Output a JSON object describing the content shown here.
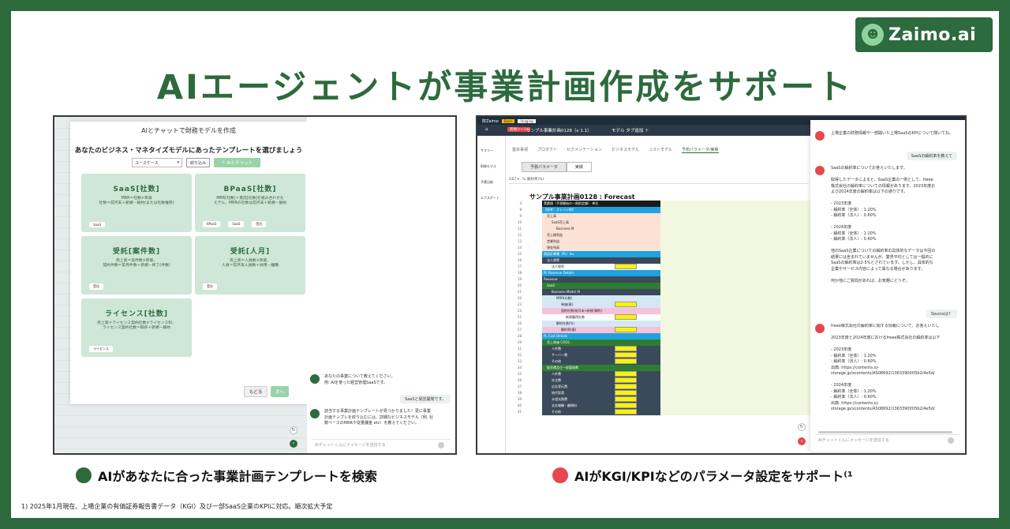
{
  "logo": {
    "text": "Zaimo.ai"
  },
  "headline": "AIエージェントが事業計画作成をサポート",
  "left": {
    "modal_title": "AIとチャットで財務モデルを作成",
    "modal_subtitle": "あなたのビジネス・マネタイズモデルにあったテンプレートを選びましょう",
    "select_value": "ユースケース",
    "filter_button": "絞り込み",
    "ai_chat_button": "AIとチャット",
    "cards": [
      {
        "title": "SaaS[社数]",
        "desc": "MRR＝社数×単価\n社数＝前月末＋新規－解約(または社数推移)",
        "tags": [
          "SaaS"
        ]
      },
      {
        "title": "BPaaS[社数]",
        "desc": "MRR[社数]＋受託[社数]を組み合わせた\nモデル。MRRの社数は前月末＋新規－解約",
        "tags": [
          "BPaaS",
          "SaaS",
          "受託"
        ]
      },
      {
        "title": "受託[案件数]",
        "desc": "売上高＝案件数×単価、\n契約件数＝前月件数＋新規－終了(件数)",
        "tags": [
          "受託"
        ]
      },
      {
        "title": "受託[人月]",
        "desc": "売上高＝人員数×単価、\n人員＝前月末人員数＋採用－離職",
        "tags": [
          "受託"
        ]
      },
      {
        "title": "ライセンス[社数]",
        "desc": "売上高＝ライセンス契約社数×ライセンス料、\nライセンス契約社数＝既存＋新規－解約",
        "tags": [
          "ライセンス"
        ]
      }
    ],
    "back_button": "もどる",
    "next_button": "次へ",
    "chat": {
      "bot1": "あなたの事業について教えてください。\n例: AIを使った経営管理SaaSです。",
      "user1": "SaaSと受託開発です。",
      "bot2": "該当する事業計画テンプレートが見つかりました！更に事業\n計画テンプレを絞り込むには、詳細なビジネスモデル（例. 社\n数ベースのMRRや従量課金 etc）を教えてください。",
      "input_placeholder": "AIチャットくんにメッセージを送信する"
    }
  },
  "right": {
    "app_name": "財Zaimo",
    "badge1": "Basic",
    "badge2": "Imaging",
    "tab_new": "新規シート",
    "tab_file": "サンプル事業計画0128（v 1.1）",
    "tab_model": "モデル タブ追加 ＋",
    "sidebar": [
      "サマリー",
      "財務モデル",
      "予実比較",
      "エクスポート"
    ],
    "subtabs": [
      "基本事項",
      "プロダクト",
      "セグメンテーション",
      "ビジネスモデル",
      "コストモデル",
      "予想パラメータ/実績"
    ],
    "toggle": [
      "予測パラメータ",
      "実績"
    ],
    "formula_bar": "G67  ▾  :  fx  解約率(%)",
    "sheet_title": "サンプル事業計画0128 : Forecast",
    "rows": [
      {
        "n": "4",
        "label": "実績値（予測開始の一期前定額）  単位",
        "bg": "#1a1a1a",
        "fg": "#fff",
        "indent": 0
      },
      {
        "n": "8",
        "label": "【参考：オレンジ枠】",
        "bg": "#1fa2e0",
        "fg": "#fff",
        "indent": 0
      },
      {
        "n": "9",
        "label": "売上高",
        "bg": "#fbe2d5",
        "fg": "#222",
        "indent": 4
      },
      {
        "n": "10",
        "label": "SaaS売上高",
        "bg": "#fbe2d5",
        "fg": "#222",
        "indent": 10
      },
      {
        "n": "11",
        "label": "Business M",
        "bg": "#fbe2d5",
        "fg": "#222",
        "indent": 16
      },
      {
        "n": "12",
        "label": "売上総利益",
        "bg": "#fbe2d5",
        "fg": "#222",
        "indent": 4
      },
      {
        "n": "13",
        "label": "営業利益",
        "bg": "#fbe2d5",
        "fg": "#222",
        "indent": 4
      },
      {
        "n": "14",
        "label": "現金残高",
        "bg": "#fbe2d5",
        "fg": "#222",
        "indent": 4
      },
      {
        "n": "15",
        "label": "損益計算書（PL）Inv",
        "bg": "#1fa2e0",
        "fg": "#fff",
        "indent": 0
      },
      {
        "n": "16",
        "label": "法人税等",
        "bg": "#3a4a5a",
        "fg": "#fff",
        "indent": 4
      },
      {
        "n": "17",
        "label": "法人税率",
        "bg": "#ffffff",
        "fg": "#222",
        "indent": 10,
        "yellow": true
      },
      {
        "n": "18",
        "label": "PL Revenue Details",
        "bg": "#1fa2e0",
        "fg": "#fff",
        "indent": 0
      },
      {
        "n": "19",
        "label": "Revenue",
        "bg": "#3a4a5a",
        "fg": "#fff",
        "indent": 0
      },
      {
        "n": "20",
        "label": "SaaS",
        "bg": "#2e7d32",
        "fg": "#fff",
        "indent": 4
      },
      {
        "n": "21",
        "label": "Business Model AI",
        "bg": "#3a4a5a",
        "fg": "#fff",
        "indent": 10
      },
      {
        "n": "22",
        "label": "MRR(社数)",
        "bg": "#d5e6f5",
        "fg": "#222",
        "indent": 16
      },
      {
        "n": "23",
        "label": "単価(値)",
        "bg": "#d5e6f5",
        "fg": "#222",
        "indent": 22,
        "yellow": true
      },
      {
        "n": "24",
        "label": "契約社数(前月末+新規-解約)",
        "bg": "#f4c2d9",
        "fg": "#222",
        "indent": 22
      },
      {
        "n": "25",
        "label": "新規獲得社数",
        "bg": "#ffffff",
        "fg": "#222",
        "indent": 28,
        "yellow": true
      },
      {
        "n": "26",
        "label": "解約社数(%)",
        "bg": "#d5e6f5",
        "fg": "#222",
        "indent": 16
      },
      {
        "n": "27",
        "label": "解約率(値)",
        "bg": "#f4c2d9",
        "fg": "#222",
        "indent": 22,
        "yellow": true
      },
      {
        "n": "28",
        "label": "PL Cost Details",
        "bg": "#1fa2e0",
        "fg": "#fff",
        "indent": 0
      },
      {
        "n": "29",
        "label": "売上原価 COGS",
        "bg": "#2e7d32",
        "fg": "#fff",
        "indent": 4
      },
      {
        "n": "31",
        "label": "人件費",
        "bg": "#3a4a5a",
        "fg": "#fff",
        "indent": 10,
        "yellow": true
      },
      {
        "n": "32",
        "label": "サーバー費",
        "bg": "#3a4a5a",
        "fg": "#fff",
        "indent": 10,
        "yellow": true
      },
      {
        "n": "33",
        "label": "その他",
        "bg": "#3a4a5a",
        "fg": "#fff",
        "indent": 10,
        "yellow": true
      },
      {
        "n": "34",
        "label": "販売費及び一般管理費",
        "bg": "#2e7d32",
        "fg": "#fff",
        "indent": 4
      },
      {
        "n": "35",
        "label": "人件費",
        "bg": "#3a4a5a",
        "fg": "#fff",
        "indent": 10,
        "yellow": true
      },
      {
        "n": "36",
        "label": "外注費",
        "bg": "#3a4a5a",
        "fg": "#fff",
        "indent": 10,
        "yellow": true
      },
      {
        "n": "37",
        "label": "広告宣伝費",
        "bg": "#3a4a5a",
        "fg": "#fff",
        "indent": 10,
        "yellow": true
      },
      {
        "n": "38",
        "label": "地代家賃",
        "bg": "#3a4a5a",
        "fg": "#fff",
        "indent": 10,
        "yellow": true
      },
      {
        "n": "39",
        "label": "水道光熱費",
        "bg": "#3a4a5a",
        "fg": "#fff",
        "indent": 10,
        "yellow": true
      },
      {
        "n": "40",
        "label": "支払報酬・顧問料",
        "bg": "#3a4a5a",
        "fg": "#fff",
        "indent": 10,
        "yellow": true
      },
      {
        "n": "41",
        "label": "その他",
        "bg": "#3a4a5a",
        "fg": "#fff",
        "indent": 10,
        "yellow": true
      }
    ],
    "chat": {
      "user0": "上場企業の財務情報や一部開いた上場SaaSのKPIについて聞いてね。",
      "user1": "SaaSの解約率を教えて",
      "bot1": "SaaSの解約率についてお答えいたします。\n\n取得したデータによると、SaaS企業の一例として、freee\n株式会社の解約率についての情報があります。2023年度お\nよび2024年度の解約率は以下の通りです。\n\n- 2023年度\n- 解約率（全体）: 1.20%\n- 解約率（法人）: 0.60%\n\n- 2024年度\n- 解約率（全体）: 1.20%\n- 解約率（法人）: 0.60%\n\n他のSaaS企業についての解約率の具体的なデータは今回の\n結果には含まれていませんが、業界平均としては一般的に\nSaaSの解約率は2-5%とされています。しかし、具体的な\n企業やサービス内容によって異なる場合があります。\n\n何か他にご質問があれば、お気軽にどうぞ。",
      "user2": "Sourceは？",
      "bot2": "freee株式会社の解約率に関する情報について、お答えいたし\n\n2023年度と2024年度におけるfreee株式会社の解約率は以下\n\n- 2023年度\n- 解約率（全体）: 1.20%\n- 解約率（法人）: 0.60%\n出典: https://contents.xj-\nstorage.jp/xcontents/AS08692/1363390f/05b2/4e5d/\n\n- 2024年度\n- 解約率（全体）: 1.20%\n- 解約率（法人）: 0.60%\n出典: https://contents.xj-\nstorage.jp/xcontents/AS08692/1363390f/05b2/4e5d/",
      "input_placeholder": "AIチャットくんにメッセージを送信する"
    }
  },
  "captions": {
    "left": "AIがあなたに合った事業計画テンプレートを検索",
    "right": "AIがKGI/KPIなどのパラメータ設定をサポート⁽¹"
  },
  "footnote": "1) 2025年1月現在、上場企業の有価証券報告書データ（KGI）及び一部SaaS企業のKPIに対応。順次拡大予定",
  "colors": {
    "brand": "#2d6a3e",
    "card": "#cfe7d6",
    "accent_red": "#e5484d"
  }
}
